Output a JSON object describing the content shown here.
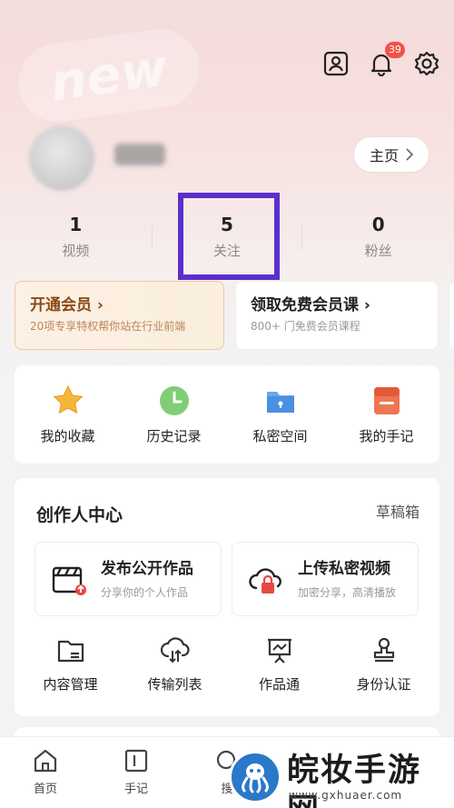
{
  "header": {
    "watermark_word": "new",
    "notification_count": "39",
    "home_button_label": "主页"
  },
  "stats": [
    {
      "value": "1",
      "label": "视频"
    },
    {
      "value": "5",
      "label": "关注"
    },
    {
      "value": "0",
      "label": "粉丝"
    }
  ],
  "highlight_color": "#5b2fcc",
  "promos": [
    {
      "title": "开通会员 ›",
      "subtitle": "20项专享特权帮你站在行业前端"
    },
    {
      "title": "领取免费会员课 ›",
      "subtitle": "800+ 门免费会员课程"
    }
  ],
  "quick_actions": [
    {
      "label": "我的收藏",
      "icon": "star-icon"
    },
    {
      "label": "历史记录",
      "icon": "clock-icon"
    },
    {
      "label": "私密空间",
      "icon": "lock-folder-icon"
    },
    {
      "label": "我的手记",
      "icon": "notebook-icon"
    }
  ],
  "creator": {
    "title": "创作人中心",
    "drafts_label": "草稿箱",
    "publish": {
      "title": "发布公开作品",
      "subtitle": "分享你的个人作品"
    },
    "upload": {
      "title": "上传私密视频",
      "subtitle": "加密分享，高清播放"
    },
    "tools": [
      {
        "label": "内容管理",
        "icon": "folder-manage-icon"
      },
      {
        "label": "传输列表",
        "icon": "cloud-transfer-icon"
      },
      {
        "label": "作品通",
        "icon": "presentation-icon"
      },
      {
        "label": "身份认证",
        "icon": "stamp-icon"
      }
    ]
  },
  "bottom_nav": [
    {
      "label": "首页",
      "icon": "home-icon"
    },
    {
      "label": "手记",
      "icon": "note-icon"
    },
    {
      "label": "搜",
      "icon": "search-icon"
    }
  ],
  "watermark": {
    "name": "皖妆手游网",
    "url": "www.gxhuaer.com"
  },
  "colors": {
    "badge": "#f0524a",
    "vip_text": "#8a4a16",
    "watermark_blue": "#2a78c9"
  }
}
